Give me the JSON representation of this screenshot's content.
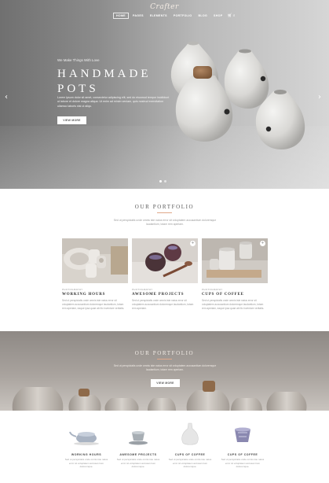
{
  "brand": {
    "logo": "Crafter"
  },
  "nav": {
    "items": [
      "HOME",
      "PAGES",
      "ELEMENTS",
      "PORTFOLIO",
      "BLOG",
      "SHOP"
    ],
    "active": "HOME",
    "icons": [
      "cart-icon",
      "search-icon"
    ]
  },
  "hero": {
    "kicker": "We Make Things With Love",
    "title_line1": "HANDMADE",
    "title_line2": "POTS",
    "text": "Lorem ipsum dolor sit amet, consectetur adipiscing elit, sed do eiusmod tempor incididunt ut labore et dolore magna aliqua. Ut enim ad minim veniam, quis nostrud exercitation ullamco laboris nisi ut aliqu.",
    "button": "VIEW MORE",
    "prev_icon": "chevron-left-icon",
    "next_icon": "chevron-right-icon",
    "slides": 2,
    "active_slide": 1
  },
  "portfolio": {
    "title": "OUR PORTFOLIO",
    "subtitle": "Sed ut perspiciatis unde omnis iste natus error sit voluptatem accusantium doloremque laudantium, totam rem aperiam.",
    "cards": [
      {
        "category": "PHOTOGRAPHY",
        "title": "WORKING HOURS",
        "desc": "Sed ut perspiciatis unde omnis iste natus error sit voluptatem accusantium doloremque laudantium, totam rem aperiam, eaque ipsa quae ab illo inventore veritatis."
      },
      {
        "category": "PHOTOGRAPHY",
        "title": "AWESOME PROJECTS",
        "desc": "Sed ut perspiciatis unde omnis iste natus error sit voluptatem accusantium doloremque laudantium, totam rem aperiam."
      },
      {
        "category": "PHOTOGRAPHY",
        "title": "CUPS OF COFFEE",
        "desc": "Sed ut perspiciatis unde omnis iste natus error sit voluptatem accusantium doloremque laudantium, totam rem aperiam, eaque ipsa quae ab illo inventore veritatis."
      }
    ],
    "plus": "+"
  },
  "band": {
    "title": "OUR PORTFOLIO",
    "subtitle": "Sed ut perspiciatis unde omnis iste natus error sit voluptatem accusantium doloremque laudantium, totam rem aperiam.",
    "button": "VIEW MORE"
  },
  "features": [
    {
      "icon": "teapot-icon",
      "title": "WORKING HOURS",
      "desc": "Sed ut perspiciatis unde omnis iste natus error sit voluptatem accusan tium doloremque."
    },
    {
      "icon": "cup-icon",
      "title": "AWESOME PROJECTS",
      "desc": "Sed ut perspiciatis unde omnis iste natus error sit voluptatem accusan tium doloremque."
    },
    {
      "icon": "vase-icon",
      "title": "CUPS OF COFFEE",
      "desc": "Sed ut perspiciatis unde omnis iste natus error sit voluptatem accusan tium doloremque."
    },
    {
      "icon": "bowl-icon",
      "title": "CUPS OF COFFEE",
      "desc": "Sed ut perspiciatis unde omnis iste natus error sit voluptatem accusan tium doloremque."
    }
  ],
  "colors": {
    "accent": "#e0a98a",
    "text": "#3a3a3a",
    "muted": "#9a9a9a"
  }
}
